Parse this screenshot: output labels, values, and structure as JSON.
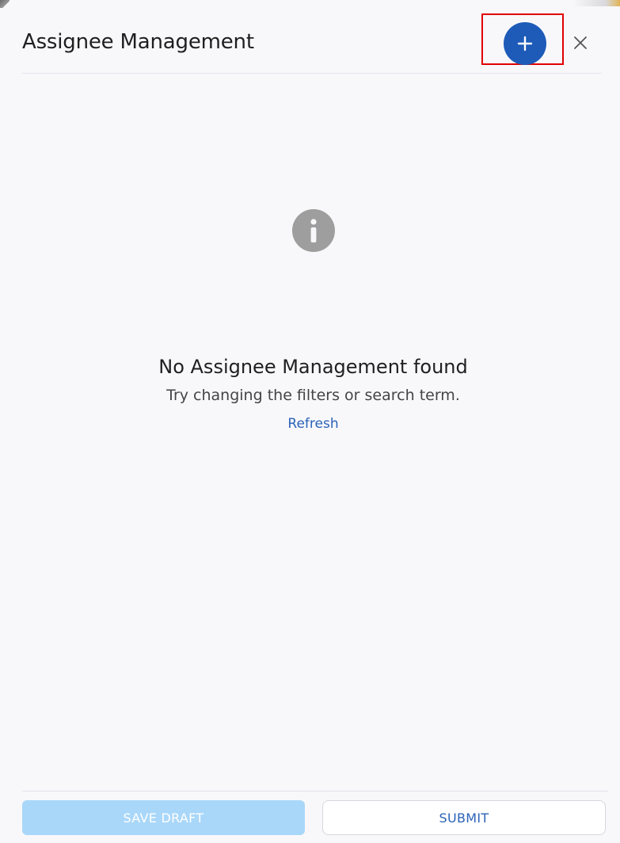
{
  "header": {
    "title": "Assignee Management",
    "add_icon": "plus-icon",
    "close_icon": "close-icon"
  },
  "empty_state": {
    "icon": "info-icon",
    "title": "No Assignee Management found",
    "subtitle": "Try changing the filters or search term.",
    "refresh_label": "Refresh"
  },
  "footer": {
    "save_draft_label": "SAVE DRAFT",
    "submit_label": "SUBMIT"
  },
  "colors": {
    "accent": "#1e5bb8",
    "link": "#2a62b8",
    "disabled_button": "#a9d7f9",
    "highlight_box": "#e00000",
    "info_icon": "#9e9e9e"
  }
}
